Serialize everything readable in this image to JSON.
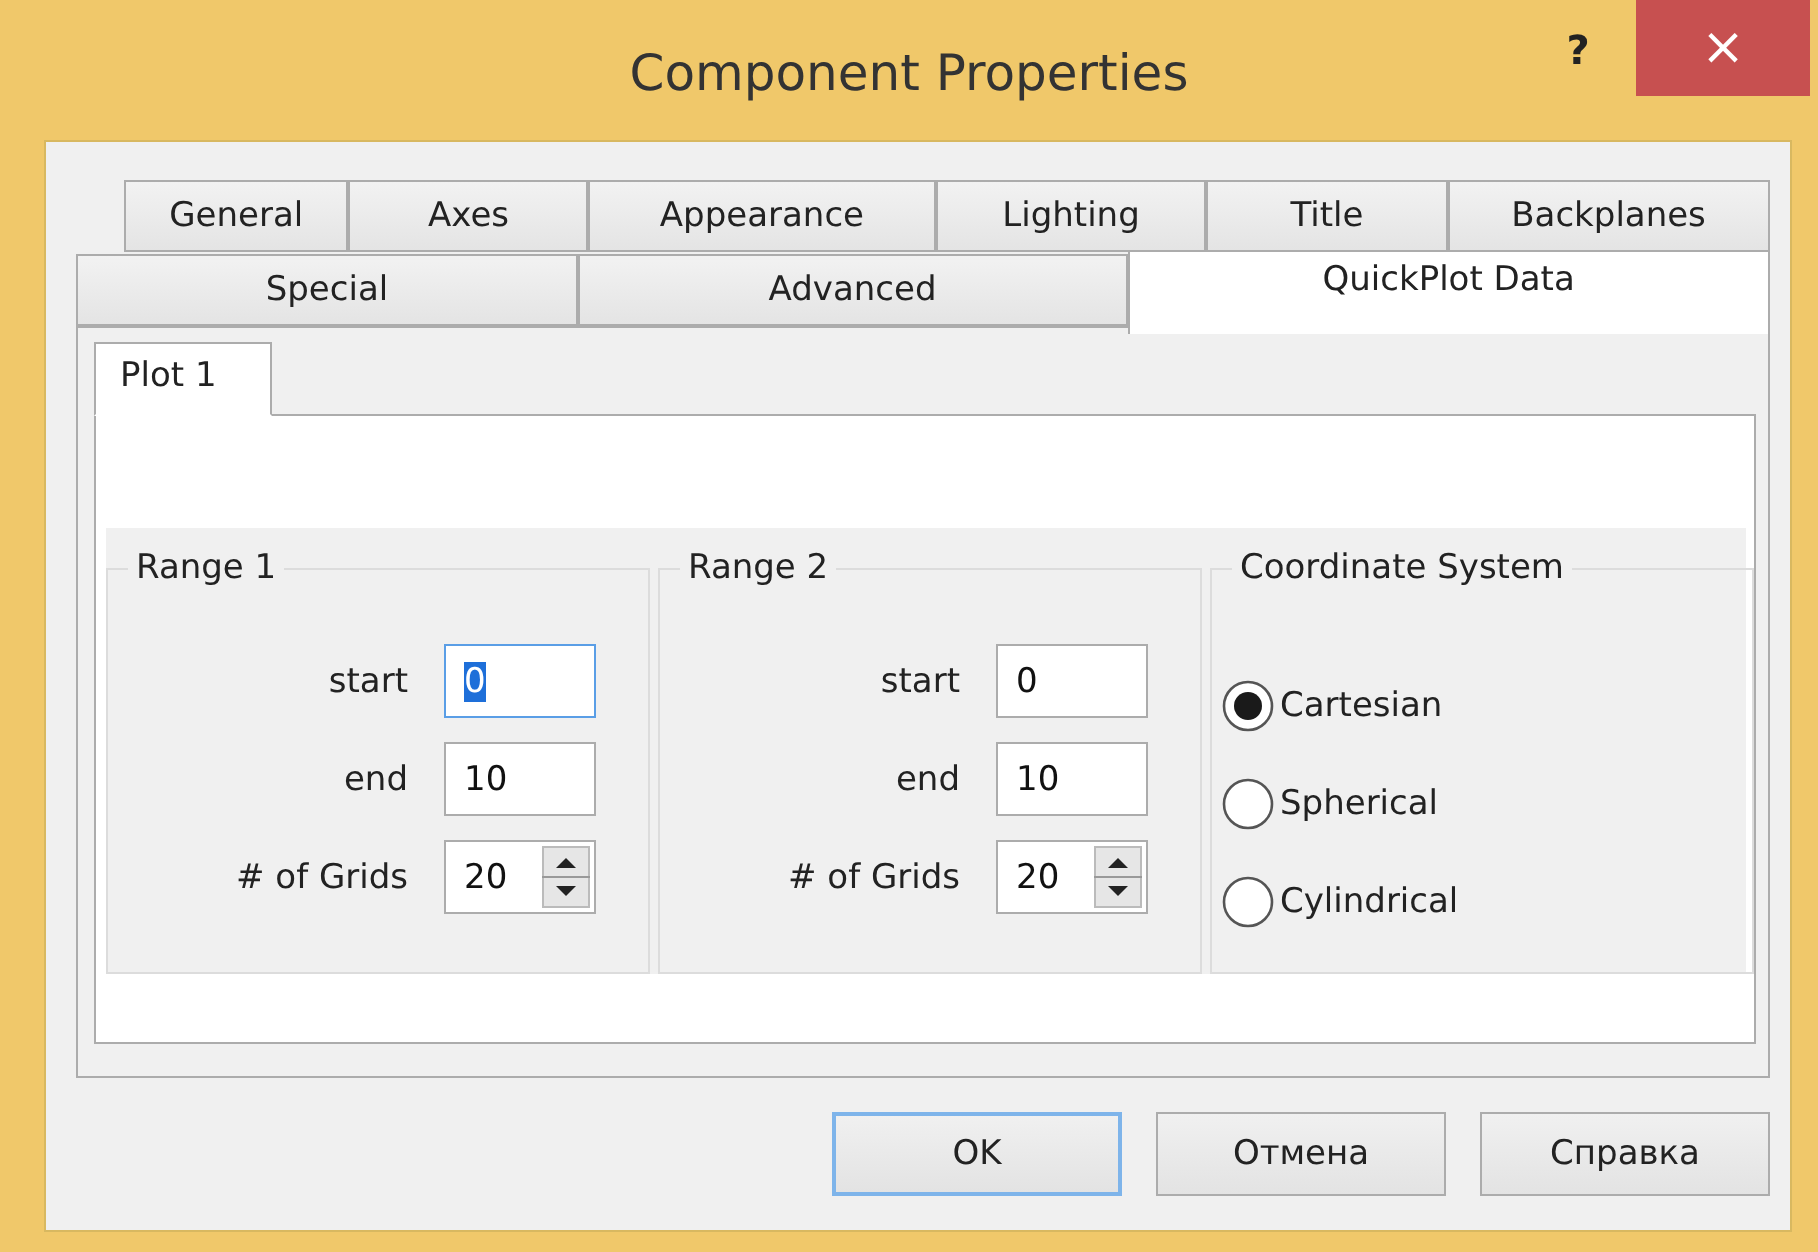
{
  "window": {
    "title": "Component Properties",
    "help": "?",
    "close": "×"
  },
  "tab_rows": [
    [
      {
        "label": "General",
        "selected": false
      },
      {
        "label": "Axes",
        "selected": false
      },
      {
        "label": "Appearance",
        "selected": false
      },
      {
        "label": "Lighting",
        "selected": false
      },
      {
        "label": "Title",
        "selected": false
      },
      {
        "label": "Backplanes",
        "selected": false
      }
    ],
    [
      {
        "label": "Special",
        "selected": false
      },
      {
        "label": "Advanced",
        "selected": false
      },
      {
        "label": "QuickPlot Data",
        "selected": true
      }
    ]
  ],
  "inner_tabs": [
    {
      "label": "Plot 1",
      "selected": true
    }
  ],
  "ranges": [
    {
      "title": "Range 1",
      "fields": [
        {
          "label": "start",
          "value": "0",
          "kind": "text",
          "focused": true
        },
        {
          "label": "end",
          "value": "10",
          "kind": "text",
          "focused": false
        },
        {
          "label": "# of Grids",
          "value": "20",
          "kind": "spinner"
        }
      ]
    },
    {
      "title": "Range 2",
      "fields": [
        {
          "label": "start",
          "value": "0",
          "kind": "text",
          "focused": false
        },
        {
          "label": "end",
          "value": "10",
          "kind": "text",
          "focused": false
        },
        {
          "label": "# of Grids",
          "value": "20",
          "kind": "spinner"
        }
      ]
    }
  ],
  "coordinate_system": {
    "title": "Coordinate System",
    "options": [
      {
        "label": "Cartesian",
        "selected": true
      },
      {
        "label": "Spherical",
        "selected": false
      },
      {
        "label": "Cylindrical",
        "selected": false
      }
    ]
  },
  "buttons": [
    {
      "label": "OK",
      "default": true
    },
    {
      "label": "Отмена",
      "default": false
    },
    {
      "label": "Справка",
      "default": false
    }
  ]
}
